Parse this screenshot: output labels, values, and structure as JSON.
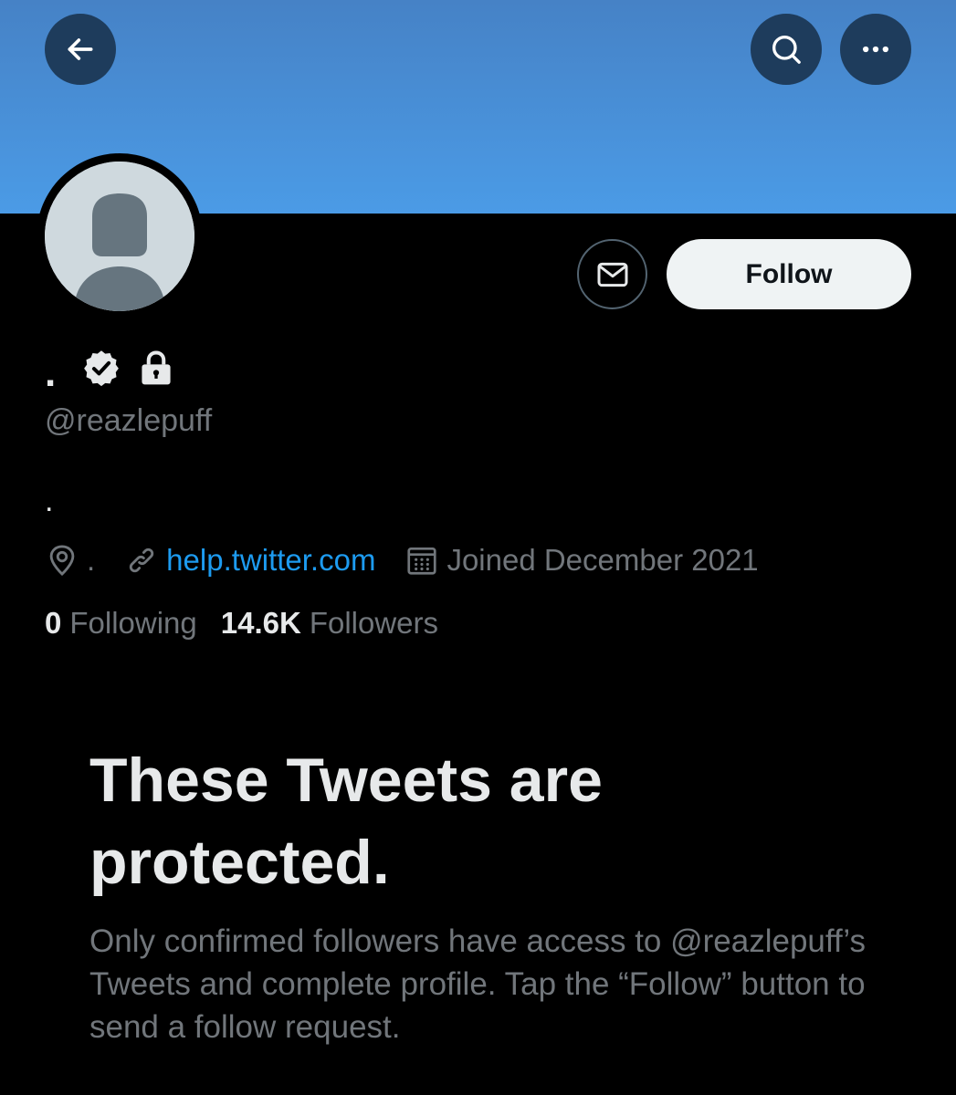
{
  "header": {
    "back_icon": "arrow-left-icon",
    "search_icon": "search-icon",
    "more_icon": "more-horizontal-icon",
    "banner_color": "#4b9be6"
  },
  "profile": {
    "display_name": ".",
    "handle": "@reazlepuff",
    "bio": ".",
    "location": ".",
    "website": "help.twitter.com",
    "joined": "Joined December 2021",
    "following_count": "0",
    "following_label": "Following",
    "followers_count": "14.6K",
    "followers_label": "Followers",
    "verified": true,
    "protected": true
  },
  "actions": {
    "message_icon": "mail-icon",
    "follow_label": "Follow"
  },
  "protected_notice": {
    "title": "These Tweets are protected.",
    "description": "Only confirmed followers have access to @reazlepuff’s Tweets and complete profile. Tap the “Follow” button to send a follow request."
  },
  "colors": {
    "accent": "#1d9bf0",
    "background": "#000000",
    "secondary_text": "#71767b"
  }
}
